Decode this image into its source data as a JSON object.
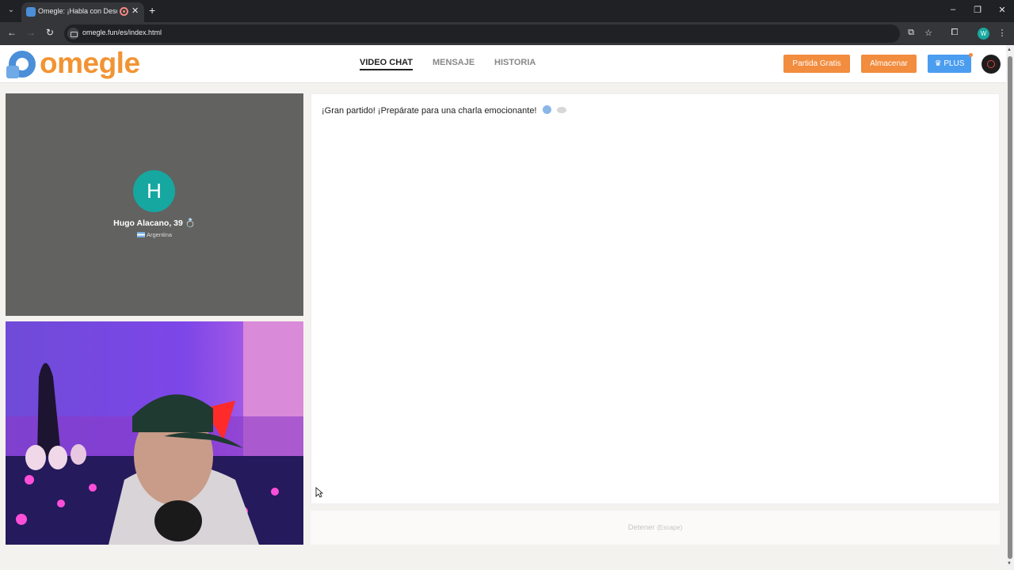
{
  "browser": {
    "tab_title": "Omegle: ¡Habla con Descon",
    "url": "omegle.fun/es/index.html",
    "profile_initial": "W"
  },
  "site": {
    "logo_text": "omegle",
    "nav": [
      "VIDEO CHAT",
      "MENSAJE",
      "HISTORIA"
    ],
    "buttons": {
      "free_match": "Partida Gratis",
      "store": "Almacenar",
      "plus": "PLUS"
    },
    "colors": {
      "brand_orange": "#f29333",
      "plus_blue": "#4b9df0",
      "avatar_teal": "#16a7a0"
    }
  },
  "stranger": {
    "initial": "H",
    "name": "Hugo Alacano, 39",
    "country": "Argentina"
  },
  "chat": {
    "message": "¡Gran partido! ¡Prepárate para una charla emocionante!",
    "stop_label": "Detener",
    "stop_hint": "(Escape)"
  }
}
